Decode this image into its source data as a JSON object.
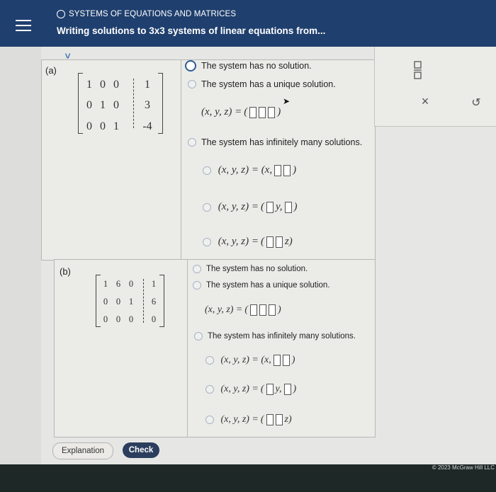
{
  "header": {
    "menu_icon": "hamburger-menu-icon",
    "subtitle": "SYSTEMS OF EQUATIONS AND MATRICES",
    "title": "Writing solutions to 3x3 systems of linear equations from..."
  },
  "part_a": {
    "label": "(a)",
    "matrix": [
      [
        "1",
        "0",
        "0",
        "1"
      ],
      [
        "0",
        "1",
        "0",
        "3"
      ],
      [
        "0",
        "0",
        "1",
        "-4"
      ]
    ],
    "options": {
      "no_solution": "The system has no solution.",
      "unique": "The system has a unique solution.",
      "unique_formula_left": "(x, y, z) =",
      "infinite": "The system has infinitely many solutions.",
      "inf1_left": "(x, y, z) = (x,",
      "inf2_left": "(x, y, z) =",
      "inf2_mid": "y,",
      "inf3_left": "(x, y, z) =",
      "inf3_right": "z)"
    }
  },
  "part_b": {
    "label": "(b)",
    "matrix": [
      [
        "1",
        "6",
        "0",
        "1"
      ],
      [
        "0",
        "0",
        "1",
        "6"
      ],
      [
        "0",
        "0",
        "0",
        "0"
      ]
    ],
    "options": {
      "no_solution": "The system has no solution.",
      "unique": "The system has a unique solution.",
      "unique_formula_left": "(x, y, z) =",
      "infinite": "The system has infinitely many solutions.",
      "inf1_left": "(x, y, z) = (x,",
      "inf2_left": "(x, y, z) =",
      "inf2_mid": "y,",
      "inf3_left": "(x, y, z) =",
      "inf3_right": "z)"
    }
  },
  "tools": {
    "fraction_icon": "fraction-icon",
    "clear_icon": "close-icon",
    "clear_symbol": "×",
    "undo_icon": "undo-icon",
    "undo_symbol": "↺"
  },
  "buttons": {
    "explanation": "Explanation",
    "check": "Check"
  },
  "footer": {
    "copyright": "© 2023 McGraw Hill LLC"
  }
}
